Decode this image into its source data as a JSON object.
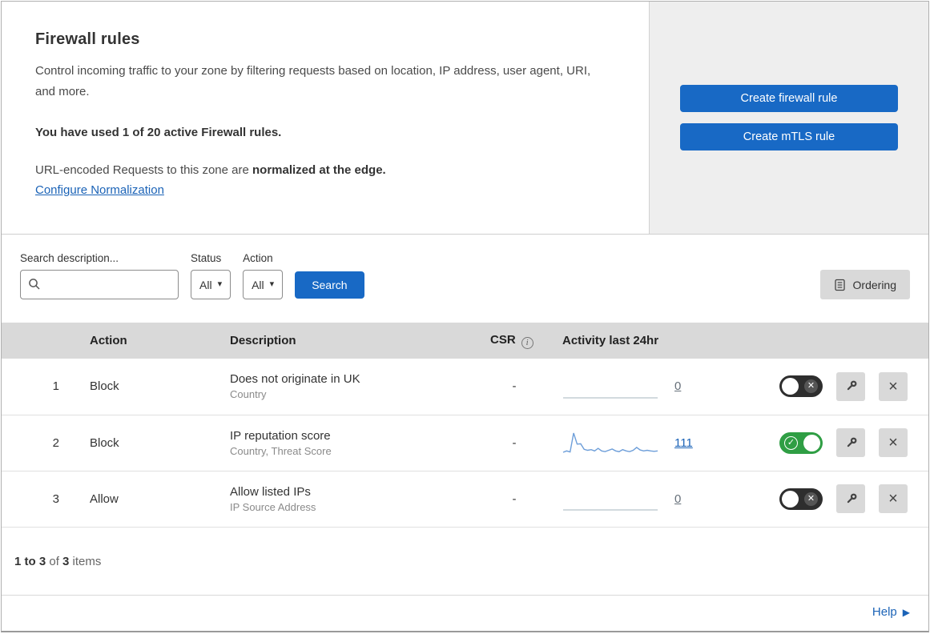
{
  "colors": {
    "accent_blue": "#1869c5",
    "link_blue": "#1b63b7",
    "toggle_green": "#2f9e44",
    "toggle_off": "#2e2e2e",
    "table_header_gray": "#d9d9d9",
    "panel_gray": "#eeeeee"
  },
  "overview": {
    "title": "Firewall rules",
    "description": "Control incoming traffic to your zone by filtering requests based on location, IP address, user agent, URI, and more.",
    "usage_note": "You have used 1 of 20 active Firewall rules.",
    "normalization_prefix": "URL-encoded Requests to this zone are ",
    "normalization_bold": "normalized at the edge.",
    "configure_link": "Configure Normalization",
    "create_firewall_button": "Create firewall rule",
    "create_mtls_button": "Create mTLS rule"
  },
  "filters": {
    "search_label": "Search description...",
    "search_value": "",
    "status_label": "Status",
    "status_value": "All",
    "action_label": "Action",
    "action_value": "All",
    "search_button": "Search",
    "ordering_button": "Ordering"
  },
  "table": {
    "headers": {
      "action": "Action",
      "description": "Description",
      "csr": "CSR",
      "activity": "Activity last 24hr"
    },
    "rows": [
      {
        "index": "1",
        "action": "Block",
        "description": "Does not originate in UK",
        "criteria": "Country",
        "csr": "-",
        "activity": "0",
        "enabled": false,
        "spark": [
          0,
          0
        ],
        "spark_color": "#c3cdd4"
      },
      {
        "index": "2",
        "action": "Block",
        "description": "IP reputation score",
        "criteria": "Country, Threat Score",
        "csr": "-",
        "activity": "111",
        "enabled": true,
        "spark": [
          5,
          9,
          6,
          64,
          30,
          31,
          14,
          11,
          13,
          9,
          17,
          9,
          7,
          11,
          15,
          9,
          7,
          13,
          9,
          7,
          11,
          20,
          12,
          9,
          11,
          9,
          8,
          9
        ],
        "spark_color": "#6d9ed9"
      },
      {
        "index": "3",
        "action": "Allow",
        "description": "Allow listed IPs",
        "criteria": "IP Source Address",
        "csr": "-",
        "activity": "0",
        "enabled": false,
        "spark": [
          0,
          0
        ],
        "spark_color": "#c3cdd4"
      }
    ]
  },
  "footer": {
    "range": "1 to 3",
    "of": " of ",
    "total": "3",
    "items": " items"
  },
  "help": {
    "label": "Help"
  },
  "icons": {
    "caret_down": "▾",
    "close": "×",
    "check": "✓",
    "cross": "✕",
    "play": "▶",
    "info": "i"
  }
}
